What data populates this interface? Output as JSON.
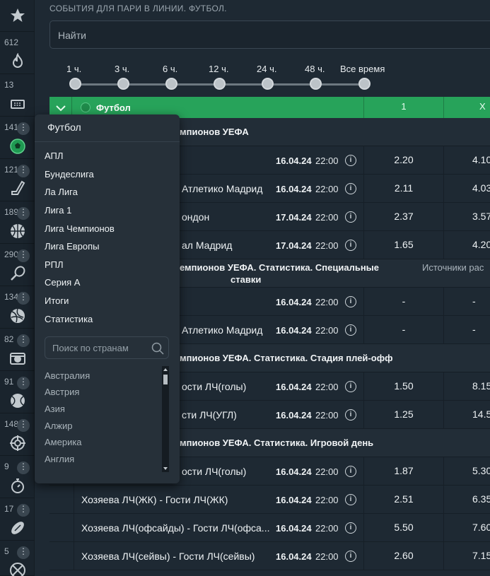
{
  "page_title": "СОБЫТИЯ ДЛЯ ПАРИ В ЛИНИИ. ФУТБОЛ.",
  "search": {
    "placeholder": "Найти"
  },
  "time_filter": {
    "labels": [
      "1 ч.",
      "3 ч.",
      "6 ч.",
      "12 ч.",
      "24 ч.",
      "48 ч.",
      "Все время"
    ],
    "selected": "Все время"
  },
  "sidebar": {
    "star_icon": "star-icon",
    "items": [
      {
        "count": "612",
        "icon": "fire-icon"
      },
      {
        "count": "13",
        "icon": "ticket-icon"
      },
      {
        "count": "1411",
        "icon": "football-icon",
        "active": true
      },
      {
        "count": "121",
        "icon": "hockey-icon"
      },
      {
        "count": "189",
        "icon": "basketball-icon"
      },
      {
        "count": "290",
        "icon": "tennis-icon"
      },
      {
        "count": "134",
        "icon": "volleyball-icon"
      },
      {
        "count": "82",
        "icon": "cybersport-icon"
      },
      {
        "count": "91",
        "icon": "ball-icon"
      },
      {
        "count": "148",
        "icon": "target-icon"
      },
      {
        "count": "9",
        "icon": "stopwatch-icon"
      },
      {
        "count": "17",
        "icon": "rugby-icon"
      },
      {
        "count": "5",
        "icon": "sport-icon"
      }
    ],
    "dots": "⋮"
  },
  "header": {
    "sport": "Футбол",
    "col1": "1",
    "colx": "X"
  },
  "leagues": [
    {
      "title": "мпионов УЕФА"
    },
    {
      "title": "емпионов УЕФА. Статистика. Специальные",
      "title2": "ставки",
      "extra": "Источники рас"
    },
    {
      "title": "мпионов УЕФА. Статистика. Стадия плей-офф"
    },
    {
      "title": "мпионов УЕФА. Статистика. Игровой день"
    }
  ],
  "events": [
    {
      "name": "",
      "date": "16.04.24",
      "time": "22:00",
      "c1": "2.20",
      "cx": "4.10"
    },
    {
      "name": "Атлетико Мадрид",
      "date": "16.04.24",
      "time": "22:00",
      "c1": "2.11",
      "cx": "4.03"
    },
    {
      "name": "ондон",
      "date": "17.04.24",
      "time": "22:00",
      "c1": "2.37",
      "cx": "3.57"
    },
    {
      "name": "ал Мадрид",
      "date": "17.04.24",
      "time": "22:00",
      "c1": "1.65",
      "cx": "4.20"
    },
    {
      "name": "",
      "date": "16.04.24",
      "time": "22:00",
      "c1": "-",
      "cx": "-"
    },
    {
      "name": "Атлетико Мадрид",
      "date": "16.04.24",
      "time": "22:00",
      "c1": "-",
      "cx": "-"
    },
    {
      "name": "ости ЛЧ(голы)",
      "date": "16.04.24",
      "time": "22:00",
      "c1": "1.50",
      "cx": "8.15"
    },
    {
      "name": "сти ЛЧ(УГЛ)",
      "date": "16.04.24",
      "time": "22:00",
      "c1": "1.25",
      "cx": "14.5"
    },
    {
      "name": "ости ЛЧ(голы)",
      "date": "16.04.24",
      "time": "22:00",
      "c1": "1.87",
      "cx": "5.30"
    },
    {
      "name": "Хозяева ЛЧ(ЖК) - Гости ЛЧ(ЖК)",
      "date": "16.04.24",
      "time": "22:00",
      "c1": "2.51",
      "cx": "6.35"
    },
    {
      "name": "Хозяева ЛЧ(офсайды) - Гости ЛЧ(офса...",
      "date": "16.04.24",
      "time": "22:00",
      "c1": "5.50",
      "cx": "7.60"
    },
    {
      "name": "Хозяева ЛЧ(сейвы) - Гости ЛЧ(сейвы)",
      "date": "16.04.24",
      "time": "22:00",
      "c1": "2.60",
      "cx": "7.15"
    }
  ],
  "dropdown": {
    "title": "Футбол",
    "leagues": [
      "АПЛ",
      "Бундеслига",
      "Ла Лига",
      "Лига 1",
      "Лига Чемпионов",
      "Лига Европы",
      "РПЛ",
      "Серия А",
      "Итоги",
      "Статистика"
    ],
    "country_search_placeholder": "Поиск по странам",
    "countries": [
      "Австралия",
      "Австрия",
      "Азия",
      "Алжир",
      "Америка",
      "Англия"
    ]
  },
  "colors": {
    "accent": "#27a35a",
    "bg": "#1e2933",
    "sidebar": "#1a242d",
    "dropdown": "#263039"
  }
}
